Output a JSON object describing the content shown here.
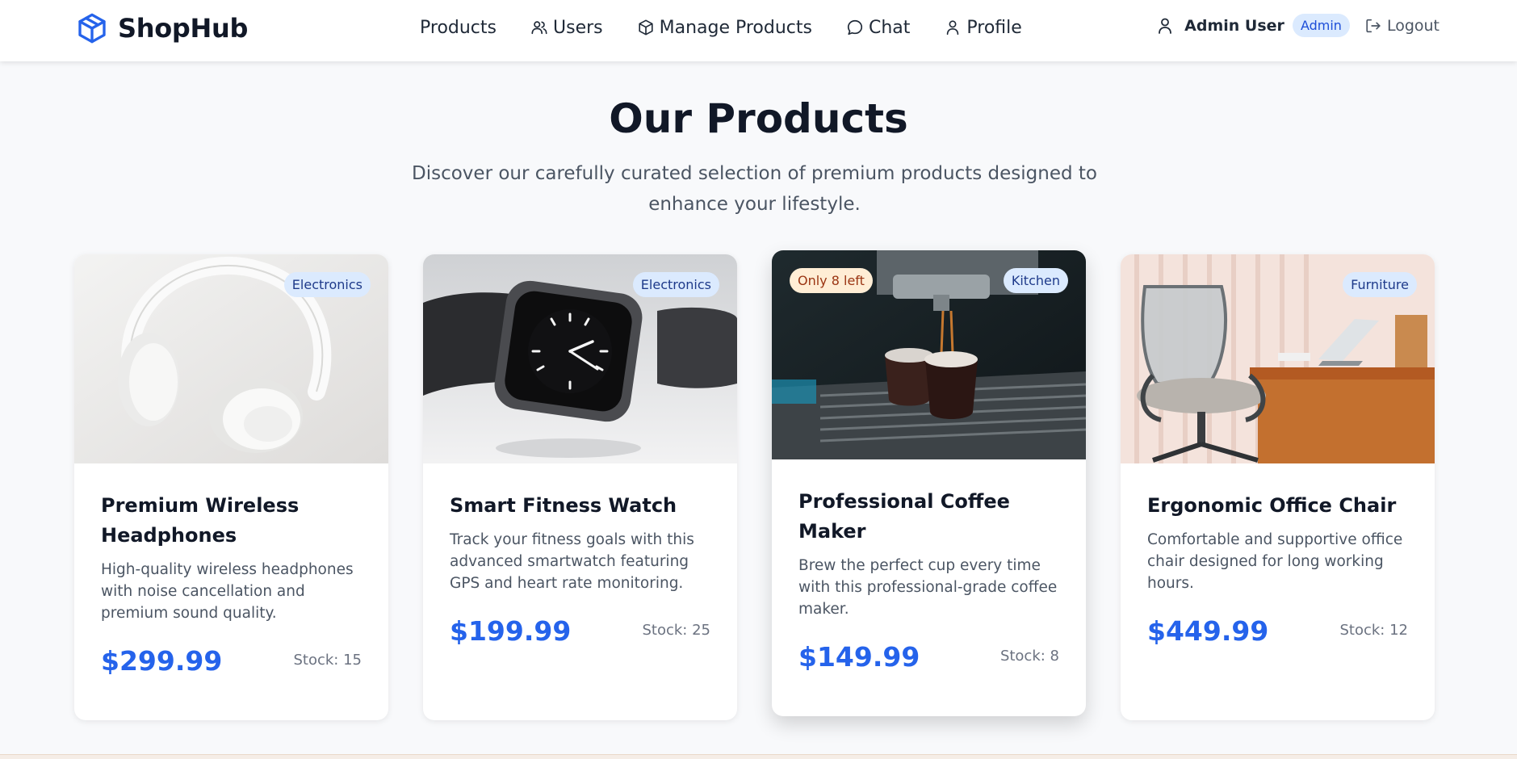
{
  "brand": {
    "name": "ShopHub",
    "icon": "cube-icon",
    "color": "#2563eb"
  },
  "nav": {
    "items": [
      {
        "label": "Products",
        "icon": ""
      },
      {
        "label": "Users",
        "icon": "users-icon"
      },
      {
        "label": "Manage Products",
        "icon": "package-icon"
      },
      {
        "label": "Chat",
        "icon": "chat-bubble-icon"
      },
      {
        "label": "Profile",
        "icon": "user-icon"
      }
    ],
    "user": {
      "name": "Admin User",
      "role": "Admin",
      "icon": "user-icon"
    },
    "logout_label": "Logout"
  },
  "hero": {
    "title": "Our Products",
    "subtitle": "Discover our carefully curated selection of premium products designed to enhance your lifestyle."
  },
  "products": [
    {
      "title": "Premium Wireless Headphones",
      "category": "Electronics",
      "description": "High-quality wireless headphones with noise cancellation and premium sound quality.",
      "price": "$299.99",
      "stock": "Stock: 15",
      "stock_badge": ""
    },
    {
      "title": "Smart Fitness Watch",
      "category": "Electronics",
      "description": "Track your fitness goals with this advanced smartwatch featuring GPS and heart rate monitoring.",
      "price": "$199.99",
      "stock": "Stock: 25",
      "stock_badge": ""
    },
    {
      "title": "Professional Coffee Maker",
      "category": "Kitchen",
      "description": "Brew the perfect cup every time with this professional-grade coffee maker.",
      "price": "$149.99",
      "stock": "Stock: 8",
      "stock_badge": "Only 8 left"
    },
    {
      "title": "Ergonomic Office Chair",
      "category": "Furniture",
      "description": "Comfortable and supportive office chair designed for long working hours.",
      "price": "$449.99",
      "stock": "Stock: 12",
      "stock_badge": ""
    }
  ],
  "colors": {
    "accent": "#2563eb",
    "badge_bg": "#dbeafe",
    "warning_bg": "#ffedd5"
  }
}
